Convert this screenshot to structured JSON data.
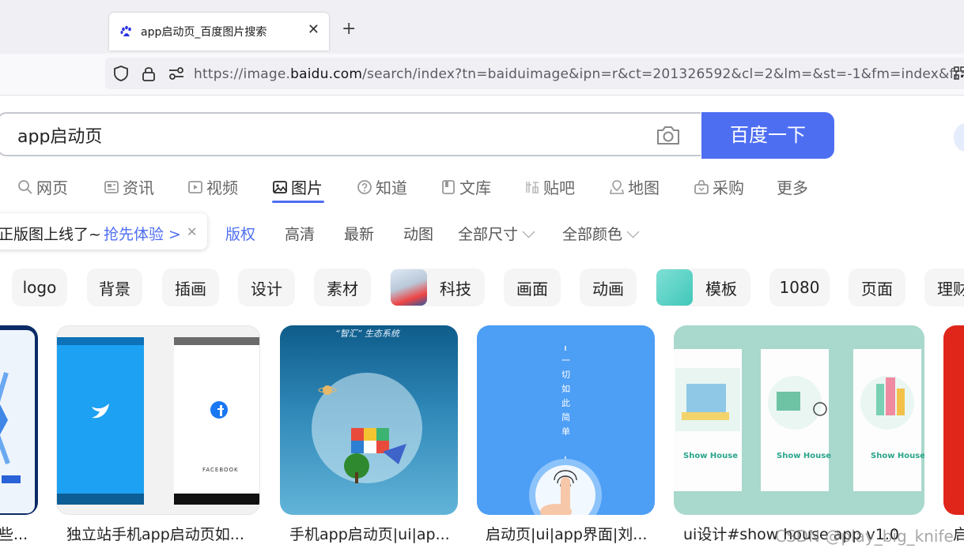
{
  "browser": {
    "prev_tab_fragment": "!",
    "tab_title": "app启动页_百度图片搜索",
    "tab_close": "✕",
    "new_tab": "+",
    "url_scheme": "https://image.",
    "url_host": "baidu.com",
    "url_path": "/search/index?tn=baiduimage&ipn=r&ct=201326592&cl=2&lm=&st=-1&fm=index&fr=&"
  },
  "search": {
    "query": "app启动页",
    "button_label": "百度一下"
  },
  "categories": [
    {
      "label": "网页",
      "icon": "search-icon"
    },
    {
      "label": "资讯",
      "icon": "news-icon"
    },
    {
      "label": "视频",
      "icon": "video-icon"
    },
    {
      "label": "图片",
      "icon": "image-icon",
      "active": true
    },
    {
      "label": "知道",
      "icon": "question-icon"
    },
    {
      "label": "文库",
      "icon": "doc-icon"
    },
    {
      "label": "贴吧",
      "icon": "tieba-icon"
    },
    {
      "label": "地图",
      "icon": "map-icon"
    },
    {
      "label": "采购",
      "icon": "bag-icon"
    },
    {
      "label": "更多"
    }
  ],
  "promo": {
    "text": "正版图上线了~",
    "link": "抢先体验 >",
    "close": "✕"
  },
  "filters": {
    "copyright": "版权",
    "hd": "高清",
    "newest": "最新",
    "animated": "动图",
    "size": "全部尺寸",
    "color": "全部颜色"
  },
  "tags": [
    "logo",
    "背景",
    "插画",
    "设计",
    "素材",
    "科技",
    "画面",
    "动画",
    "模板",
    "1080",
    "页面",
    "理财"
  ],
  "results": [
    {
      "caption": "些..."
    },
    {
      "caption": "独立站手机app启动页如..."
    },
    {
      "caption": "手机app启动页|ui|ap..."
    },
    {
      "caption": "启动页|ui|app界面|刘..."
    },
    {
      "caption": "ui设计#show house app v1.0"
    },
    {
      "caption": "启"
    }
  ],
  "image_text": {
    "card2_brand": "FACEBOOK",
    "card3_title": "“智汇” 生态系统",
    "card4_vertical": "一切如此简单",
    "card5_brand": "Show House"
  },
  "watermark": "CSDN @play_big_knife",
  "colors": {
    "accent": "#4e6ef2",
    "twitter_blue": "#1da1f2",
    "card5_bg": "#a9d8cc"
  }
}
